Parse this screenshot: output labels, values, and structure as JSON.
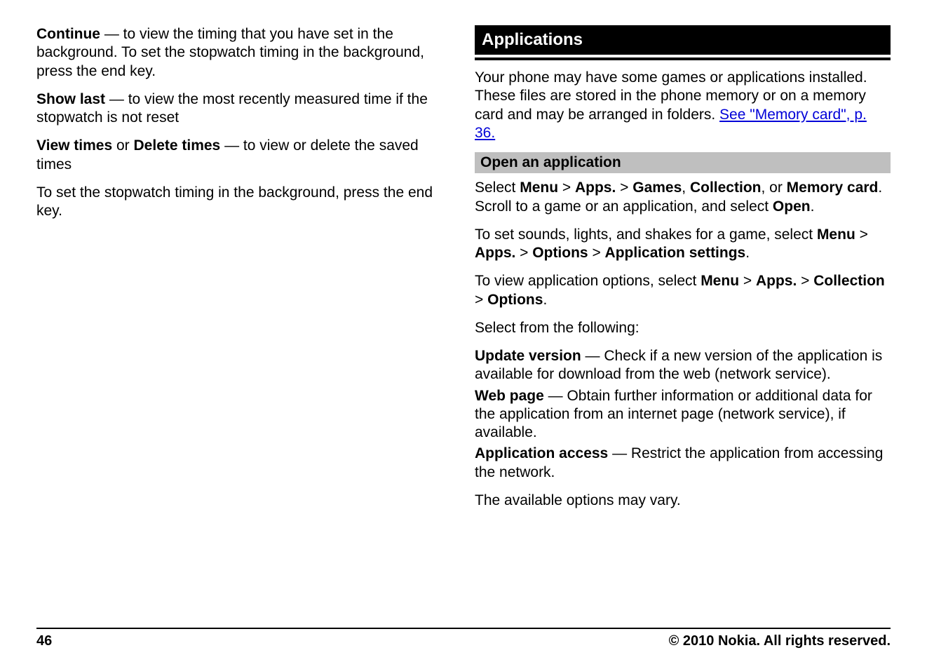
{
  "left": {
    "p1": {
      "b": "Continue",
      "t": "  — to view the timing that you have set in the background. To set the stopwatch timing in the background, press the end key."
    },
    "p2": {
      "b": "Show last",
      "t": "  — to view the most recently measured time if the stopwatch is not reset"
    },
    "p3": {
      "b1": "View times",
      "mid": " or ",
      "b2": "Delete times",
      "t": " — to view or delete the saved times"
    },
    "p4": "To set the stopwatch timing in the background, press the end key."
  },
  "right": {
    "header": "Applications",
    "intro1": "Your phone may have some games or applications installed. These files are stored in the phone memory or on a memory card and may be arranged in folders. ",
    "link": "See \"Memory card\", p. 36.",
    "sub1": "Open an application",
    "s1": {
      "pre": "Select ",
      "b1": "Menu",
      "gt1": " > ",
      "b2": "Apps.",
      "gt2": " > ",
      "b3": "Games",
      "c1": ", ",
      "b4": "Collection",
      "c2": ", or ",
      "b5": "Memory card",
      "post1": ". Scroll to a game or an application, and select ",
      "b6": "Open",
      "post2": "."
    },
    "s2": {
      "pre": "To set sounds, lights, and shakes for a game, select ",
      "b1": "Menu",
      "gt1": " > ",
      "b2": "Apps.",
      "gt2": " > ",
      "b3": "Options",
      "gt3": " > ",
      "b4": "Application settings",
      "post": "."
    },
    "s3": {
      "pre": "To view application options, select ",
      "b1": "Menu",
      "gt1": " > ",
      "b2": "Apps.",
      "gt2": " > ",
      "b3": "Collection",
      "gt3": " > ",
      "b4": "Options",
      "post": "."
    },
    "selectFrom": "Select from the following:",
    "opt1": {
      "b": "Update version",
      "t": "  — Check if a new version of the application is available for download from the web (network service)."
    },
    "opt2": {
      "b": "Web page",
      "t": "  — Obtain further information or additional data for the application from an internet page (network service), if available."
    },
    "opt3": {
      "b": "Application access",
      "t": "  — Restrict the application from accessing the network."
    },
    "tail": "The available options may vary."
  },
  "footer": {
    "page": "46",
    "copyright": "© 2010 Nokia. All rights reserved."
  }
}
